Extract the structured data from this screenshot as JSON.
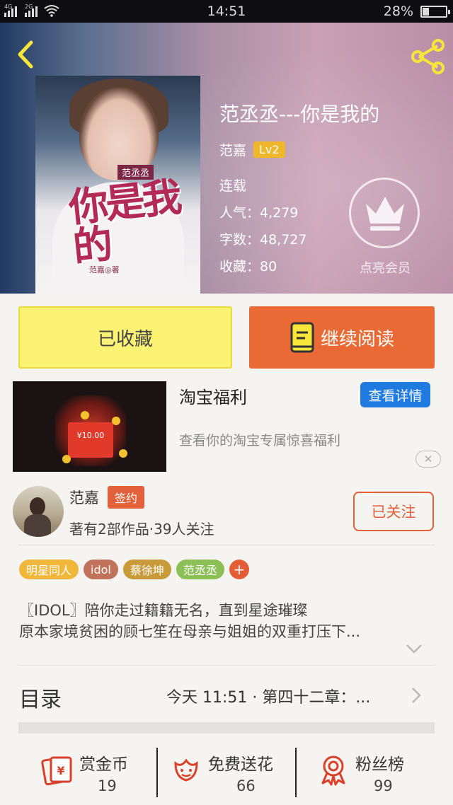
{
  "status_bar": {
    "time": "14:51",
    "battery": "28%",
    "net1": "4G",
    "net2": "2G"
  },
  "header": {
    "back_icon": "chevron-left-icon",
    "share_icon": "share-icon"
  },
  "book": {
    "cover_series": "范丞丞",
    "cover_title": "你是我的",
    "cover_author": "范嘉◎著",
    "title": "范丞丞---你是我的",
    "author": "范嘉",
    "level": "Lv2",
    "status": "连载",
    "popularity": "人气：4,279",
    "words": "字数：48,727",
    "favorites": "收藏：80",
    "vip_label": "点亮会员"
  },
  "actions": {
    "collected_label": "已收藏",
    "read_label": "继续阅读"
  },
  "ad": {
    "title": "淘宝福利",
    "detail_label": "查看详情",
    "desc": "查看你的淘宝专属惊喜福利",
    "image_price": "¥10.00",
    "close_label": "✕"
  },
  "author_card": {
    "name": "范嘉",
    "signed_label": "签约",
    "stats": "著有2部作品·39人关注",
    "follow_label": "已关注"
  },
  "tags": [
    {
      "label": "明星同人",
      "color": "#f0b73a"
    },
    {
      "label": "idol",
      "color": "#c0735a"
    },
    {
      "label": "蔡徐坤",
      "color": "#c99a3a"
    },
    {
      "label": "范丞丞",
      "color": "#8cbf56"
    }
  ],
  "tag_add_label": "+",
  "synopsis": {
    "line1": "〖IDOL〗陪你走过籍籍无名，直到星途璀璨",
    "line2": "原本家境贫困的顾七笙在母亲与姐姐的双重打压下..."
  },
  "catalog": {
    "title": "目录",
    "latest": "今天 11:51 · 第四十二章：..."
  },
  "bottom_bar": [
    {
      "label": "赏金币",
      "count": "19",
      "icon": "coin-envelope-icon"
    },
    {
      "label": "免费送花",
      "count": "66",
      "icon": "flower-icon"
    },
    {
      "label": "粉丝榜",
      "count": "99",
      "icon": "medal-icon"
    }
  ],
  "colors": {
    "accent_orange": "#ea6a35",
    "collect_yellow": "#fcf375",
    "link_blue": "#1f7be0",
    "brand_red": "#d8412a"
  }
}
